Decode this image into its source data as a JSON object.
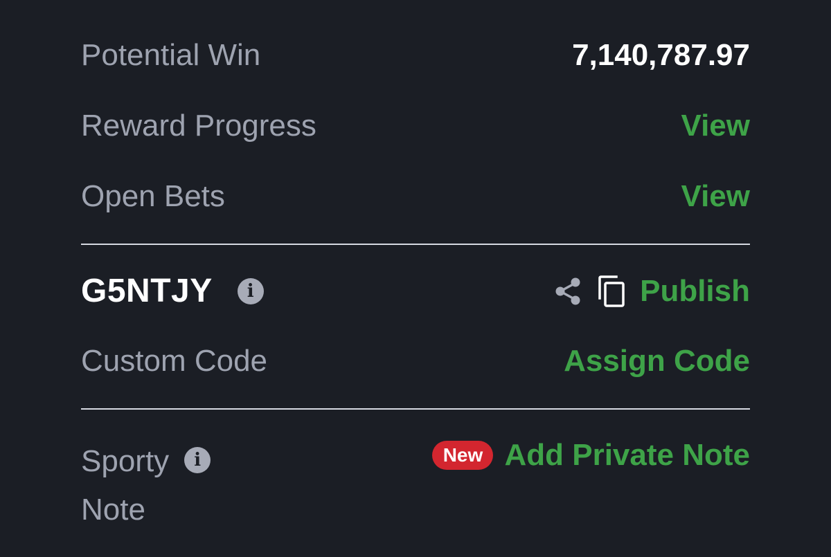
{
  "summary": {
    "potential_win": {
      "label": "Potential Win",
      "value": "7,140,787.97"
    },
    "reward_progress": {
      "label": "Reward Progress",
      "action": "View"
    },
    "open_bets": {
      "label": "Open Bets",
      "action": "View"
    }
  },
  "booking": {
    "code": "G5NTJY",
    "publish_label": "Publish",
    "custom_code": {
      "label": "Custom Code",
      "action": "Assign Code"
    }
  },
  "note": {
    "label_line1": "Sporty",
    "label_line2": "Note",
    "badge": "New",
    "action": "Add Private Note"
  },
  "icons": {
    "info": "info-icon",
    "share": "share-icon",
    "copy": "copy-icon"
  },
  "colors": {
    "background": "#1b1e25",
    "label": "#9ea3b0",
    "value": "#ffffff",
    "accent_green": "#3ea348",
    "badge_red": "#d3262f",
    "divider": "#d7dae2"
  }
}
